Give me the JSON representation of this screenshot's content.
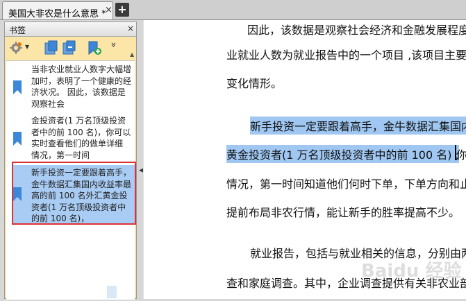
{
  "tab": {
    "title": "美国大非农是什么意思 *",
    "close": "×",
    "add": "+"
  },
  "pane": {
    "title": "书签",
    "close": "×",
    "toolbar": {
      "settings_icon": "gear-icon",
      "expand": "»"
    },
    "bookmarks": [
      {
        "text": "当非农业就业人数字大幅增加时，表明了一个健康的经济状况。 因此，该数据是观察社会",
        "selected": false
      },
      {
        "text": "金投资者(1 万名顶级投资者中的前 100 名)，你可以实时查看他们的做单详细 情况，第一时间",
        "selected": false
      },
      {
        "text": "新手投资一定要跟着高手，金牛数据汇集国内收益率最高的前 100 名外汇黄金投资者(1 万名顶级投资者中的前 100 名)，",
        "selected": true
      }
    ]
  },
  "document": {
    "lines": [
      "因此，该数据是观察社会经济和金融发展程度",
      "业就业人数为就业报告中的一个项目 ,该项目主要",
      "变化情形。",
      "新手投资一定要跟着高手，金牛数据汇集国内",
      "黄金投资者(1 万名顶级投资者中的前 100 名) ,",
      "你",
      "情况，第一时间知道他们何时下单，下单方向和止",
      "提前布局非农行情，能让新手的胜率提高不少。",
      "就业报告，包括与就业相关的信息，分别由两",
      "查和家庭调查。其中，企业调查提供有关非农业部"
    ],
    "watermark": "Baidu 经验"
  },
  "colors": {
    "highlight": "#9fc7f2",
    "selection_outline": "#e03131",
    "pane_bg": "#fbe6a8"
  }
}
